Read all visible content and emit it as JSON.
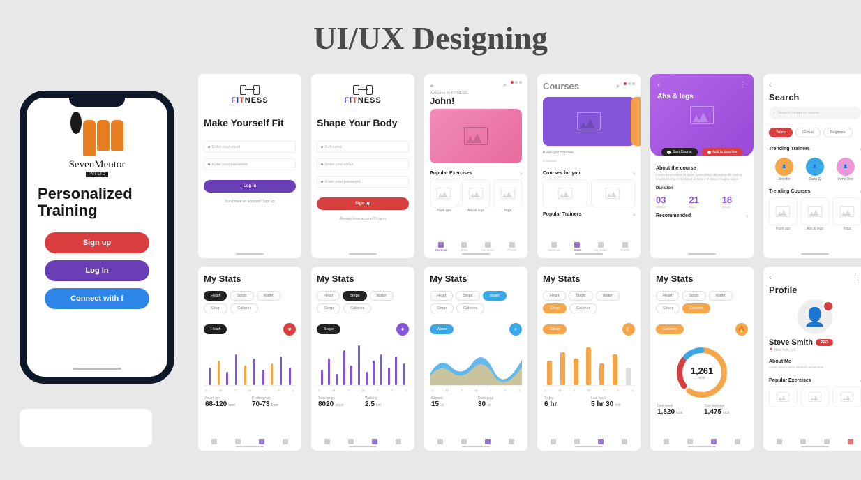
{
  "page_title": "UI/UX Designing",
  "colors": {
    "red": "#d83e3e",
    "purple": "#6a3fb5",
    "blue": "#2e87e8",
    "orange": "#f5a54a",
    "violet": "#8455d8"
  },
  "phone": {
    "logo_text": "SevenMentor",
    "logo_badge": "PVT LTD",
    "headline": "Personalized Training",
    "signup": "Sign up",
    "login": "Log In",
    "connect": "Connect with  f"
  },
  "s1": {
    "brand_fi": "Fi",
    "brand_t": "T",
    "brand_ness": "NESS",
    "headline": "Make Yourself Fit",
    "email_ph": "Enter your email",
    "pass_ph": "Enter your password",
    "login_btn": "Log in",
    "footer": "Don't have an account? Sign up"
  },
  "s2": {
    "headline": "Shape Your Body",
    "name_ph": "Full name",
    "email_ph": "Enter your email",
    "pass_ph": "Enter your password",
    "signup_btn": "Sign up",
    "footer": "Already have account? Log in"
  },
  "s3": {
    "welcome": "Welcome to FITNESS",
    "name": "John!",
    "section": "Popular Exercises",
    "thumbs": [
      "Push ups",
      "Abs & legs",
      "Yoga"
    ],
    "tabs": [
      "Workout",
      "Stats",
      "My Stats",
      "Profile"
    ]
  },
  "s4": {
    "title": "Courses",
    "sub1": "Push-ups courses",
    "sub1b": "8 courses",
    "section1": "Courses for you",
    "section2": "Popular Trainers"
  },
  "s5": {
    "title": "Abs & legs",
    "start": "Start Course",
    "fav": "Add to favorites",
    "about_h": "About the course",
    "about": "Lorem ipsum dolor sit amet, consectetur adipiscing elit, sed do eiusmod tempor incididunt ut labore et dolore magna aliqua.",
    "duration": "Duration",
    "d1": "03",
    "d1l": "Weeks",
    "d2": "21",
    "d2l": "Days",
    "d3": "18",
    "d3l": "Hours",
    "rec": "Recommended"
  },
  "s6": {
    "title": "Search",
    "placeholder": "Search trainer or course",
    "filters": [
      "Yours",
      "Global",
      "Beginner"
    ],
    "section1": "Trending Trainers",
    "trainers": [
      "Jennifer",
      "Dario Q",
      "Irene Dee"
    ],
    "section2": "Trending Courses",
    "thumbs": [
      "Push ups",
      "Abs & legs",
      "Yoga"
    ]
  },
  "s7": {
    "title": "My Stats",
    "chips": [
      "Heart",
      "Steps",
      "Water",
      "Sleep",
      "Calories"
    ],
    "selected": "Heart",
    "axis": [
      "S",
      "M",
      "T",
      "W",
      "T",
      "F",
      "S"
    ],
    "m1l": "Heart rate",
    "m1v": "68-120",
    "m1u": "bpm",
    "m2l": "Resting rate",
    "m2v": "70-73",
    "m2u": "bpm"
  },
  "s8": {
    "title": "My Stats",
    "selected": "Steps",
    "m1l": "Total steps",
    "m1v": "8020",
    "m1u": "steps",
    "m2l": "Walking",
    "m2v": "2.5",
    "m2u": "km"
  },
  "s9": {
    "title": "My Stats",
    "selected": "Water",
    "m1l": "Current",
    "m1v": "15",
    "m1u": "oz",
    "m2l": "Daily goal",
    "m2v": "30",
    "m2u": "oz"
  },
  "s10": {
    "title": "My Stats",
    "selected": "Sleep",
    "m1l": "Today",
    "m1v": "6 hr",
    "m1u": "",
    "m2l": "Last week",
    "m2v": "5 hr 30",
    "m2u": "min"
  },
  "s11": {
    "title": "My Stats",
    "selected": "Calories",
    "center": "1,261",
    "center_u": "kcal",
    "m1l": "Last week",
    "m1v": "1,820",
    "m1u": "kcal",
    "m2l": "Your average",
    "m2v": "1,475",
    "m2u": "kcal"
  },
  "s12": {
    "title": "Profile",
    "name": "Steve Smith",
    "badge": "PRO",
    "loc": "New York, US",
    "about_h": "About Me",
    "about": "Lorem ipsum dolor sit amet consectetur",
    "section": "Popular Exercises"
  }
}
